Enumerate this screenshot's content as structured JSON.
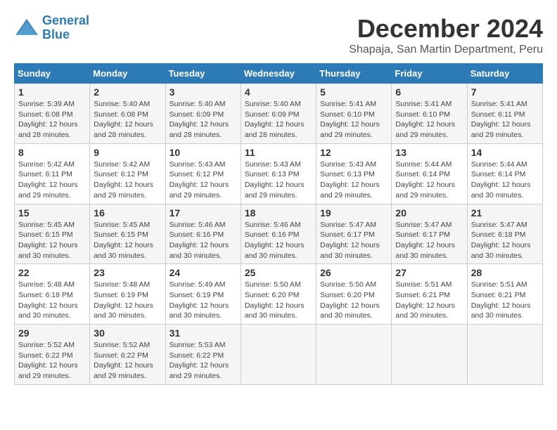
{
  "header": {
    "logo_line1": "General",
    "logo_line2": "Blue",
    "month": "December 2024",
    "location": "Shapaja, San Martin Department, Peru"
  },
  "weekdays": [
    "Sunday",
    "Monday",
    "Tuesday",
    "Wednesday",
    "Thursday",
    "Friday",
    "Saturday"
  ],
  "weeks": [
    [
      {
        "day": "1",
        "sunrise": "5:39 AM",
        "sunset": "6:08 PM",
        "daylight": "12 hours and 28 minutes."
      },
      {
        "day": "2",
        "sunrise": "5:40 AM",
        "sunset": "6:08 PM",
        "daylight": "12 hours and 28 minutes."
      },
      {
        "day": "3",
        "sunrise": "5:40 AM",
        "sunset": "6:09 PM",
        "daylight": "12 hours and 28 minutes."
      },
      {
        "day": "4",
        "sunrise": "5:40 AM",
        "sunset": "6:09 PM",
        "daylight": "12 hours and 28 minutes."
      },
      {
        "day": "5",
        "sunrise": "5:41 AM",
        "sunset": "6:10 PM",
        "daylight": "12 hours and 29 minutes."
      },
      {
        "day": "6",
        "sunrise": "5:41 AM",
        "sunset": "6:10 PM",
        "daylight": "12 hours and 29 minutes."
      },
      {
        "day": "7",
        "sunrise": "5:41 AM",
        "sunset": "6:11 PM",
        "daylight": "12 hours and 29 minutes."
      }
    ],
    [
      {
        "day": "8",
        "sunrise": "5:42 AM",
        "sunset": "6:11 PM",
        "daylight": "12 hours and 29 minutes."
      },
      {
        "day": "9",
        "sunrise": "5:42 AM",
        "sunset": "6:12 PM",
        "daylight": "12 hours and 29 minutes."
      },
      {
        "day": "10",
        "sunrise": "5:43 AM",
        "sunset": "6:12 PM",
        "daylight": "12 hours and 29 minutes."
      },
      {
        "day": "11",
        "sunrise": "5:43 AM",
        "sunset": "6:13 PM",
        "daylight": "12 hours and 29 minutes."
      },
      {
        "day": "12",
        "sunrise": "5:43 AM",
        "sunset": "6:13 PM",
        "daylight": "12 hours and 29 minutes."
      },
      {
        "day": "13",
        "sunrise": "5:44 AM",
        "sunset": "6:14 PM",
        "daylight": "12 hours and 29 minutes."
      },
      {
        "day": "14",
        "sunrise": "5:44 AM",
        "sunset": "6:14 PM",
        "daylight": "12 hours and 30 minutes."
      }
    ],
    [
      {
        "day": "15",
        "sunrise": "5:45 AM",
        "sunset": "6:15 PM",
        "daylight": "12 hours and 30 minutes."
      },
      {
        "day": "16",
        "sunrise": "5:45 AM",
        "sunset": "6:15 PM",
        "daylight": "12 hours and 30 minutes."
      },
      {
        "day": "17",
        "sunrise": "5:46 AM",
        "sunset": "6:16 PM",
        "daylight": "12 hours and 30 minutes."
      },
      {
        "day": "18",
        "sunrise": "5:46 AM",
        "sunset": "6:16 PM",
        "daylight": "12 hours and 30 minutes."
      },
      {
        "day": "19",
        "sunrise": "5:47 AM",
        "sunset": "6:17 PM",
        "daylight": "12 hours and 30 minutes."
      },
      {
        "day": "20",
        "sunrise": "5:47 AM",
        "sunset": "6:17 PM",
        "daylight": "12 hours and 30 minutes."
      },
      {
        "day": "21",
        "sunrise": "5:47 AM",
        "sunset": "6:18 PM",
        "daylight": "12 hours and 30 minutes."
      }
    ],
    [
      {
        "day": "22",
        "sunrise": "5:48 AM",
        "sunset": "6:18 PM",
        "daylight": "12 hours and 30 minutes."
      },
      {
        "day": "23",
        "sunrise": "5:48 AM",
        "sunset": "6:19 PM",
        "daylight": "12 hours and 30 minutes."
      },
      {
        "day": "24",
        "sunrise": "5:49 AM",
        "sunset": "6:19 PM",
        "daylight": "12 hours and 30 minutes."
      },
      {
        "day": "25",
        "sunrise": "5:50 AM",
        "sunset": "6:20 PM",
        "daylight": "12 hours and 30 minutes."
      },
      {
        "day": "26",
        "sunrise": "5:50 AM",
        "sunset": "6:20 PM",
        "daylight": "12 hours and 30 minutes."
      },
      {
        "day": "27",
        "sunrise": "5:51 AM",
        "sunset": "6:21 PM",
        "daylight": "12 hours and 30 minutes."
      },
      {
        "day": "28",
        "sunrise": "5:51 AM",
        "sunset": "6:21 PM",
        "daylight": "12 hours and 30 minutes."
      }
    ],
    [
      {
        "day": "29",
        "sunrise": "5:52 AM",
        "sunset": "6:22 PM",
        "daylight": "12 hours and 29 minutes."
      },
      {
        "day": "30",
        "sunrise": "5:52 AM",
        "sunset": "6:22 PM",
        "daylight": "12 hours and 29 minutes."
      },
      {
        "day": "31",
        "sunrise": "5:53 AM",
        "sunset": "6:22 PM",
        "daylight": "12 hours and 29 minutes."
      },
      null,
      null,
      null,
      null
    ]
  ]
}
